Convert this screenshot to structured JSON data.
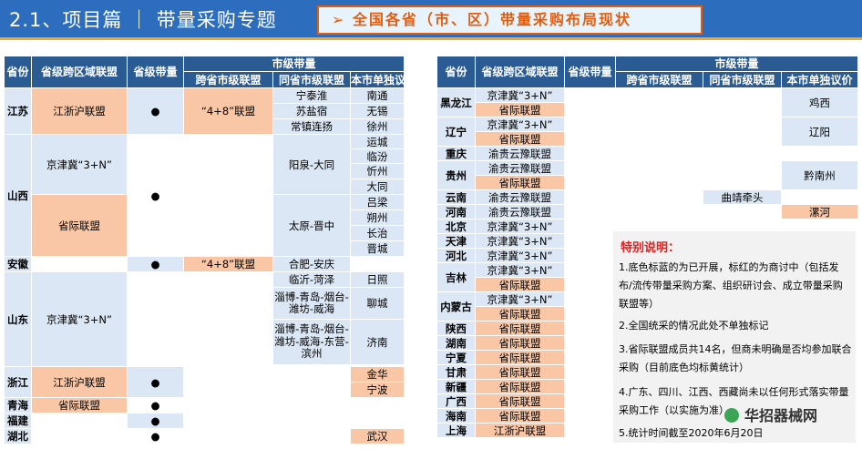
{
  "header": {
    "title": "2.1、项目篇 ｜ 带量采购专题",
    "banner": "➢ 全国各省（市、区）带量采购布局现状"
  },
  "table_headers": {
    "province": "省份",
    "cross_region": "省级跨区域联盟",
    "provincial": "省级带量",
    "city_group": "市级带量",
    "cross_province_city": "跨省市级联盟",
    "same_province_city": "同省市级联盟",
    "city_solo": "本市单独议价"
  },
  "dot": "●",
  "left": {
    "jiangsu": {
      "name": "江苏",
      "alliance": "江浙沪联盟",
      "cross_city": "“4+8”联盟",
      "same_city": [
        "宁泰淮",
        "苏盐宿",
        "常镇连扬"
      ],
      "solo": [
        "南通",
        "无锡",
        "徐州"
      ]
    },
    "shanxi": {
      "name": "山西",
      "alliance1": "京津冀“3+N”",
      "alliance2": "省际联盟",
      "same_city1": "阳泉-大同",
      "same_city2": "太原-晋中",
      "solo": [
        "运城",
        "临汾",
        "忻州",
        "大同",
        "吕梁",
        "朔州",
        "长治",
        "晋城"
      ]
    },
    "anhui": {
      "name": "安徽",
      "cross_city": "“4+8”联盟",
      "same_city": "合肥-安庆"
    },
    "shandong": {
      "name": "山东",
      "alliance": "京津冀“3+N”",
      "same_city": [
        "临沂-菏泽",
        "淄博-青岛-烟台-潍坊-威海",
        "淄博-青岛-烟台-潍坊-威海-东营-滨州"
      ],
      "solo": [
        "日照",
        "聊城",
        "济南"
      ]
    },
    "zhejiang": {
      "name": "浙江",
      "alliance": "江浙沪联盟",
      "solo": [
        "金华",
        "宁波"
      ]
    },
    "qinghai": {
      "name": "青海",
      "alliance": "省际联盟"
    },
    "fujian": {
      "name": "福建"
    },
    "hubei": {
      "name": "湖北",
      "solo": "武汉"
    }
  },
  "right": {
    "heilongjiang": {
      "name": "黑龙江",
      "a1": "京津冀“3+N”",
      "a2": "省际联盟",
      "solo": "鸡西"
    },
    "liaoning": {
      "name": "辽宁",
      "a1": "京津冀“3+N”",
      "a2": "省际联盟",
      "solo": "辽阳"
    },
    "chongqing": {
      "name": "重庆",
      "a1": "渝贵云豫联盟"
    },
    "guizhou": {
      "name": "贵州",
      "a1": "渝贵云豫联盟",
      "a2": "省际联盟",
      "solo": "黔南州"
    },
    "yunnan": {
      "name": "云南",
      "a1": "渝贵云豫联盟",
      "same_city": "曲靖牵头"
    },
    "henan": {
      "name": "河南",
      "a1": "渝贵云豫联盟",
      "solo": "漯河"
    },
    "beijing": {
      "name": "北京",
      "a1": "京津冀“3+N”"
    },
    "tianjin": {
      "name": "天津",
      "a1": "京津冀“3+N”"
    },
    "hebei": {
      "name": "河北",
      "a1": "京津冀“3+N”"
    },
    "jilin": {
      "name": "吉林",
      "a1": "京津冀“3+N”",
      "a2": "省际联盟"
    },
    "neimenggu": {
      "name": "内蒙古",
      "a1": "京津冀“3+N”",
      "a2": "省际联盟"
    },
    "shaanxi": {
      "name": "陕西",
      "a1": "省际联盟"
    },
    "hunan": {
      "name": "湖南",
      "a1": "省际联盟"
    },
    "ningxia": {
      "name": "宁夏",
      "a1": "省际联盟"
    },
    "gansu": {
      "name": "甘肃",
      "a1": "省际联盟"
    },
    "xinjiang": {
      "name": "新疆",
      "a1": "省际联盟"
    },
    "guangxi": {
      "name": "广西",
      "a1": "省际联盟"
    },
    "hainan": {
      "name": "海南",
      "a1": "省际联盟"
    },
    "shanghai": {
      "name": "上海",
      "a1": "江浙沪联盟"
    }
  },
  "note": {
    "title": "特别说明：",
    "items": [
      "1.底色标蓝的为已开展，标红的为商讨中（包括发布/流传带量采购方案、组织研讨会、成立带量采购联盟等）",
      "2.全国统采的情况此处不单独标记",
      "3.省际联盟成员共14名，但商未明确是否均参加联合采购（目前底色均标黄统计）",
      "4.广东、四川、江西、西藏尚未以任何形式落实带量采购工作（以实施为准）",
      "5.统计时间截至2020年6月20日"
    ]
  },
  "watermark": "华招器械网"
}
